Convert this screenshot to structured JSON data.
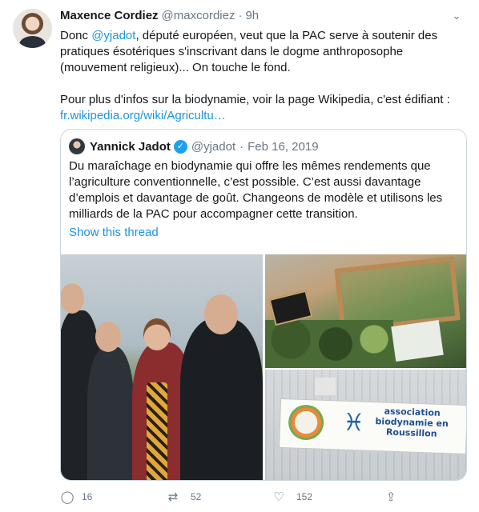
{
  "tweet": {
    "author_name": "Maxence Cordiez",
    "author_handle": "@maxcordiez",
    "separator": "·",
    "timestamp": "9h",
    "text_part1_prefix": "Donc ",
    "text_mention": "@yjadot",
    "text_part1_suffix": ", député européen, veut que la PAC serve à soutenir des pratiques ésotériques s'inscrivant dans le dogme anthroposophe (mouvement religieux)... On touche le fond.",
    "text_part2": "Pour plus d'infos sur la biodynamie, voir la page Wikipedia, c'est édifiant :",
    "text_link": "fr.wikipedia.org/wiki/Agricultu…"
  },
  "quote": {
    "author_name": "Yannick Jadot",
    "verified_mark": "✓",
    "author_handle": "@yjadot",
    "separator": "·",
    "date": "Feb 16, 2019",
    "text": "Du maraîchage en biodynamie qui offre les mêmes rendements que l’agriculture conventionnelle, c’est possible. C’est aussi davantage d’emplois et davantage de goût. Changeons de modèle et utilisons les milliards de la PAC pour accompagner cette transition.",
    "show_thread": "Show this thread",
    "banner_title": "association biodynamie en Roussillon",
    "banner_mark": "♓"
  },
  "actions": {
    "reply_count": "16",
    "retweet_count": "52",
    "like_count": "152",
    "reply_icon": "◯",
    "retweet_icon": "⇄",
    "like_icon": "♡",
    "share_icon": "⇪"
  },
  "icons": {
    "caret": "⌄"
  },
  "colors": {
    "link": "#1b95e0",
    "verified": "#1da1f2",
    "secondary_text": "#657786",
    "border": "#ccd6dd"
  }
}
